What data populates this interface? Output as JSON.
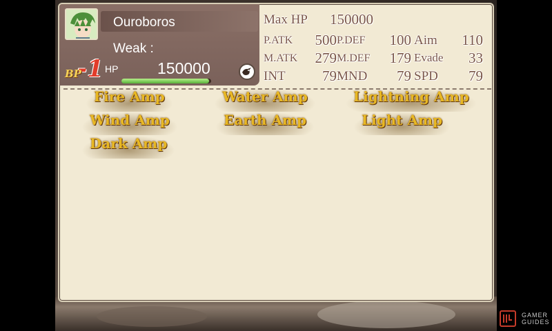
{
  "character": {
    "name": "Ouroboros",
    "weak_label": "Weak :",
    "weak_value": "",
    "bp_label": "BP",
    "bp_value": "-1",
    "hp_label": "HP",
    "hp_value": "150000",
    "hp_fill_fraction": 0.98
  },
  "stats": {
    "max_hp_label": "Max HP",
    "max_hp_value": "150000",
    "patk_label": "P.ATK",
    "patk_value": "500",
    "pdef_label": "P.DEF",
    "pdef_value": "100",
    "aim_label": "Aim",
    "aim_value": "110",
    "matk_label": "M.ATK",
    "matk_value": "279",
    "mdef_label": "M.DEF",
    "mdef_value": "179",
    "evade_label": "Evade",
    "evade_value": "33",
    "int_label": "INT",
    "int_value": "79",
    "mnd_label": "MND",
    "mnd_value": "79",
    "spd_label": "SPD",
    "spd_value": "79"
  },
  "abilities": [
    "Fire Amp",
    "Water Amp",
    "Lightning Amp",
    "Wind Amp",
    "Earth Amp",
    "Light Amp",
    "Dark Amp"
  ],
  "watermark": {
    "line1": "GAMER",
    "line2": "GUIDES"
  },
  "colors": {
    "panel_bg": "#f2ead4",
    "character_box": "#7a615a",
    "stat_text": "#7a5647",
    "ability_text": "#e8b824",
    "bp_value": "#e23c2a",
    "hp_bar": "#58b23a"
  },
  "icons": {
    "portrait": "character-portrait",
    "bird": "bird-emblem-icon",
    "logo": "gamer-guides-logo"
  }
}
